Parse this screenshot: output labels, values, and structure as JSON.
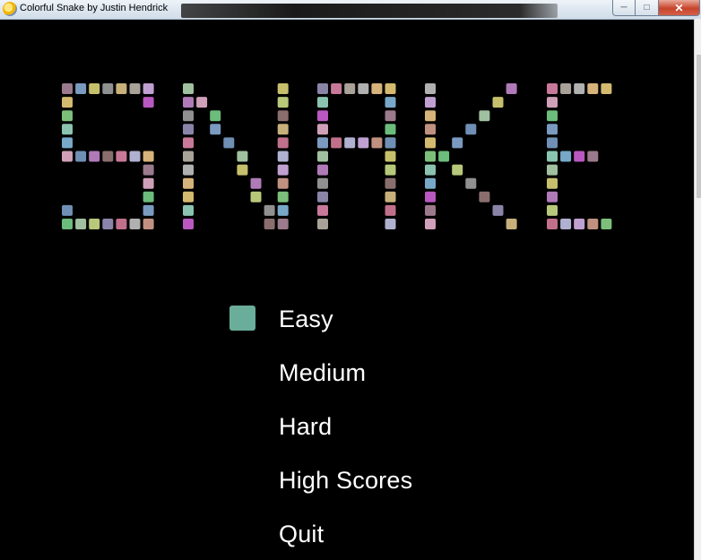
{
  "window": {
    "title": "Colorful Snake by Justin Hendrick",
    "icon": "python-icon",
    "buttons": [
      "minimize",
      "maximize",
      "close"
    ]
  },
  "logo": {
    "text": "SNAKE",
    "block_colors": [
      "#b07ab8",
      "#7bbf7a",
      "#8a84a8",
      "#9a7a8c",
      "#a8a298",
      "#6f8fb5",
      "#d6b37a",
      "#b8c87a",
      "#8ac4b0",
      "#c8b07a",
      "#d0a0b8",
      "#b0b0d0",
      "#a0c0a0",
      "#c09080",
      "#909090",
      "#78a8c8",
      "#c87898",
      "#6cbc7c",
      "#b0b0b0",
      "#c6c06c",
      "#d3ba6e",
      "#8a6e6e",
      "#b858c0",
      "#c0708a",
      "#7a9ac0",
      "#c0a0d0"
    ]
  },
  "menu": {
    "items": [
      "Easy",
      "Medium",
      "Hard",
      "High Scores",
      "Quit"
    ],
    "selected_index": 0,
    "selector_color": "#6aae9a"
  }
}
